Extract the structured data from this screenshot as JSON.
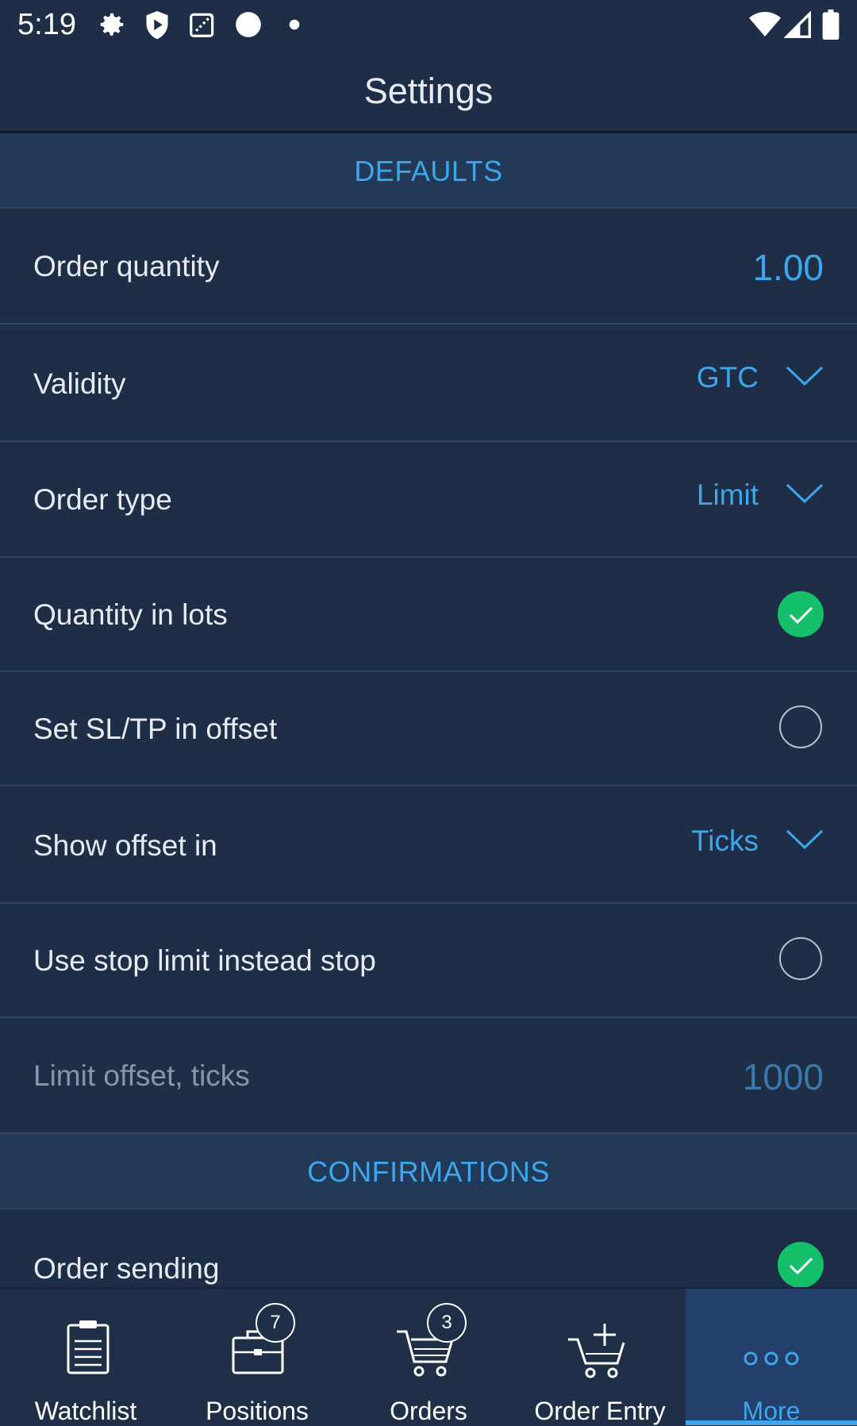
{
  "status_bar": {
    "time": "5:19"
  },
  "app_bar": {
    "title": "Settings"
  },
  "sections": {
    "defaults": "DEFAULTS",
    "confirmations": "CONFIRMATIONS"
  },
  "rows": {
    "order_quantity": {
      "label": "Order quantity",
      "value": "1.00"
    },
    "validity": {
      "label": "Validity",
      "value": "GTC"
    },
    "order_type": {
      "label": "Order type",
      "value": "Limit"
    },
    "quantity_in_lots": {
      "label": "Quantity in lots",
      "checked": true
    },
    "set_sltp_offset": {
      "label": "Set SL/TP in offset",
      "checked": false
    },
    "show_offset_in": {
      "label": "Show offset in",
      "value": "Ticks"
    },
    "use_stop_limit": {
      "label": "Use stop limit instead stop",
      "checked": false
    },
    "limit_offset": {
      "label": "Limit offset, ticks",
      "value": "1000"
    },
    "order_sending": {
      "label": "Order sending",
      "checked": true
    }
  },
  "bottom_nav": {
    "watchlist": "Watchlist",
    "positions": "Positions",
    "positions_badge": "7",
    "orders": "Orders",
    "orders_badge": "3",
    "order_entry": "Order Entry",
    "more": "More"
  },
  "colors": {
    "background": "#1e2e47",
    "accent": "#3ea6ea",
    "check_green": "#16c06a"
  }
}
